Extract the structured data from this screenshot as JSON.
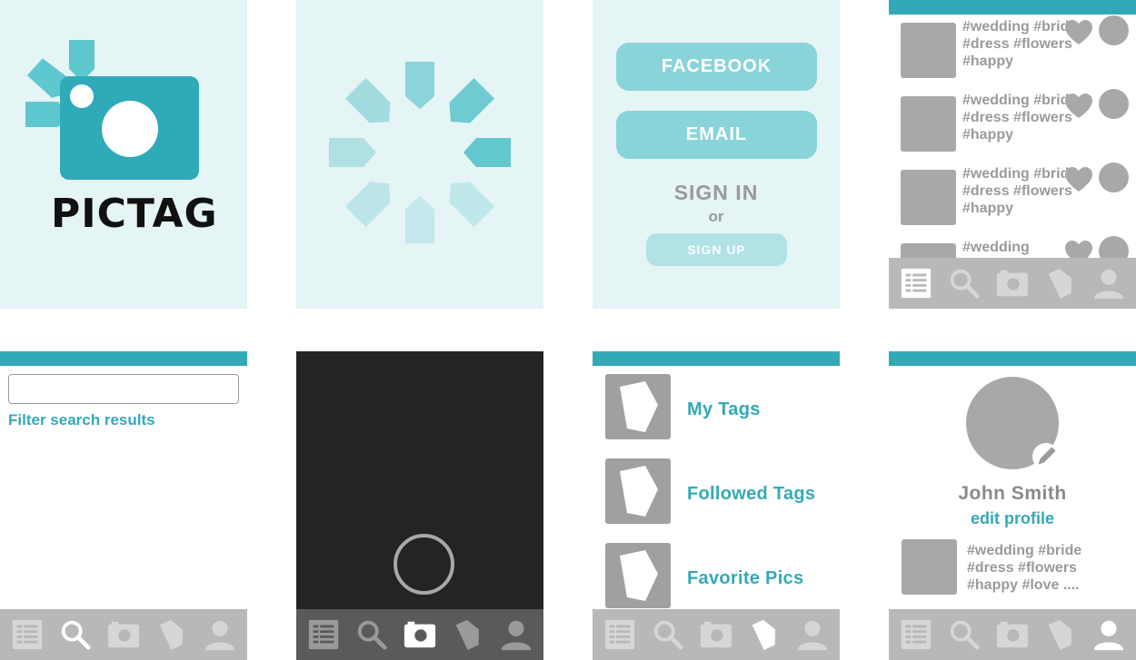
{
  "colors": {
    "screen_bg": "#e5f4f5",
    "accent": "#34a9b6",
    "light_accent": "#88d4d9",
    "logo_teal": "#2faab8",
    "gray": "#a8a8a8",
    "nav_bg": "#b8b8b8",
    "camera_bg": "#242424"
  },
  "splash": {
    "logo_text": "PICTAG"
  },
  "login": {
    "facebook_label": "FACEBOOK",
    "email_label": "EMAIL",
    "signin_label": "SIGN IN",
    "or_label": "or",
    "signup_label": "SIGN UP"
  },
  "feed": {
    "items": [
      {
        "tags": "#wedding #bride #dress #flowers #happy"
      },
      {
        "tags": "#wedding #bride #dress #flowers #happy"
      },
      {
        "tags": "#wedding #bride #dress #flowers #happy"
      },
      {
        "tags": "#wedding"
      }
    ]
  },
  "search": {
    "input_value": "",
    "input_placeholder": "",
    "filter_label": "Filter search results"
  },
  "tags_screen": {
    "rows": [
      {
        "label": "My Tags"
      },
      {
        "label": "Followed Tags"
      },
      {
        "label": "Favorite Pics"
      }
    ]
  },
  "profile": {
    "name": "John Smith",
    "edit_label": "edit profile",
    "post_tags": "#wedding #bride #dress #flowers #happy #love ...."
  },
  "nav": {
    "icons": [
      "list-icon",
      "search-icon",
      "camera-icon",
      "tag-icon",
      "user-icon"
    ],
    "active_by_screen": {
      "feed": "none",
      "search": "search-icon",
      "camera": "camera-icon",
      "tags": "tag-icon",
      "profile": "user-icon"
    }
  }
}
